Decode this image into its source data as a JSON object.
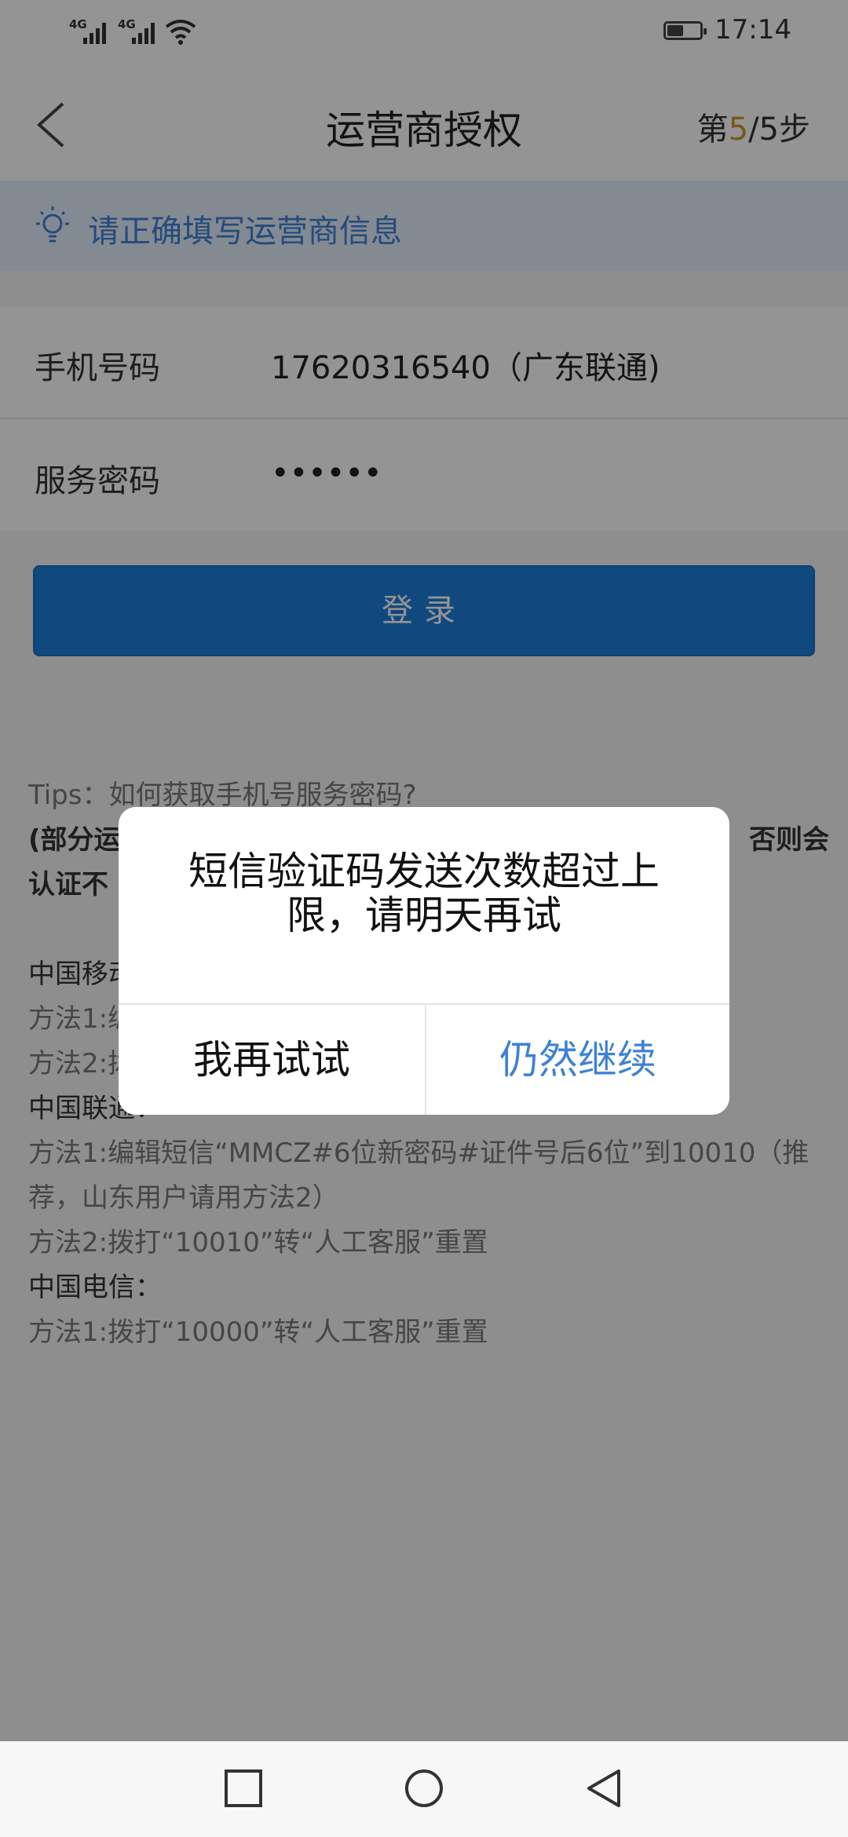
{
  "status_bar": {
    "signal1": "4G",
    "signal2": "4G",
    "time": "17:14"
  },
  "nav": {
    "title": "运营商授权",
    "step_prefix": "第",
    "step_current": "5",
    "step_suffix": "/5步"
  },
  "notice": {
    "text": "请正确填写运营商信息"
  },
  "form": {
    "phone_label": "手机号码",
    "phone_value": "17620316540（广东联通)",
    "password_label": "服务密码",
    "password_value": "••••••"
  },
  "login_button": "登录",
  "tips": {
    "title": "Tips：如何获取手机号服务密码?",
    "note_left_1": "(部分运",
    "note_right": "否则会",
    "note_left_2": "认证不",
    "mobile_head": "中国移动",
    "mobile_m1": "方法1:编",
    "mobile_m2": "方法2:拨",
    "unicom_head": "中国联通：",
    "unicom_m1": "方法1:编辑短信“MMCZ#6位新密码#证件号后6位”到10010（推荐，山东用户请用方法2）",
    "unicom_m2": "方法2:拨打“10010”转“人工客服”重置",
    "telecom_head": "中国电信：",
    "telecom_m1": "方法1:拨打“10000”转“人工客服”重置"
  },
  "dialog": {
    "message": "短信验证码发送次数超过上限，请明天再试",
    "cancel_label": "我再试试",
    "confirm_label": "仍然继续"
  },
  "colors": {
    "accent": "#3e82d4",
    "login_button": "#1a7fda",
    "step_highlight": "#c99a2e"
  }
}
